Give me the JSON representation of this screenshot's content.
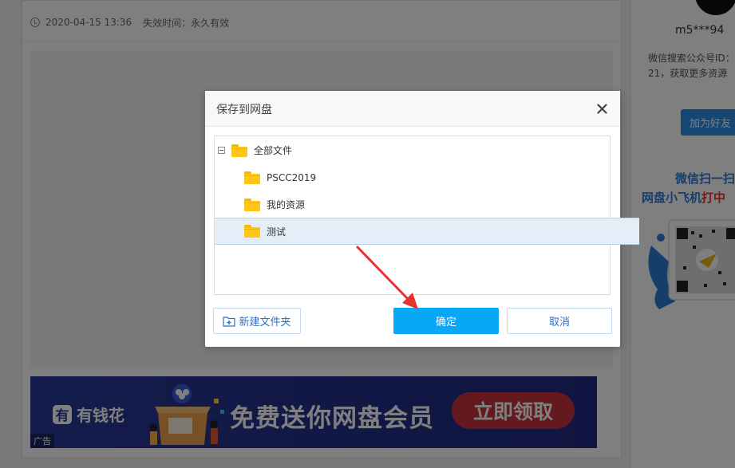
{
  "page": {
    "meta": {
      "date": "2020-04-15 13:36",
      "expiry": "失效时间：永久有效"
    },
    "ad": {
      "brand": "有钱花",
      "brand_mark": "有",
      "headline": "免费送你网盘会员",
      "cta": "立即领取",
      "tag": "广告"
    }
  },
  "sidebar": {
    "username": "m5***94",
    "info": "微信搜索公众号ID：21，获取更多资源",
    "add_friend": "加为好友",
    "promo_line1": "微信扫一扫",
    "promo_line2_a": "网盘小飞机",
    "promo_line2_b": "打中"
  },
  "dialog": {
    "title": "保存到网盘",
    "tree": {
      "root": "全部文件",
      "children": [
        "PSCC2019",
        "我的资源",
        "测试"
      ],
      "selected": "测试"
    },
    "buttons": {
      "new_folder": "新建文件夹",
      "confirm": "确定",
      "cancel": "取消"
    }
  },
  "colors": {
    "confirm": "#09a8f7",
    "folder": "#ffc61a",
    "selected_row": "#e4eef9",
    "arrow": "#e8322f"
  }
}
